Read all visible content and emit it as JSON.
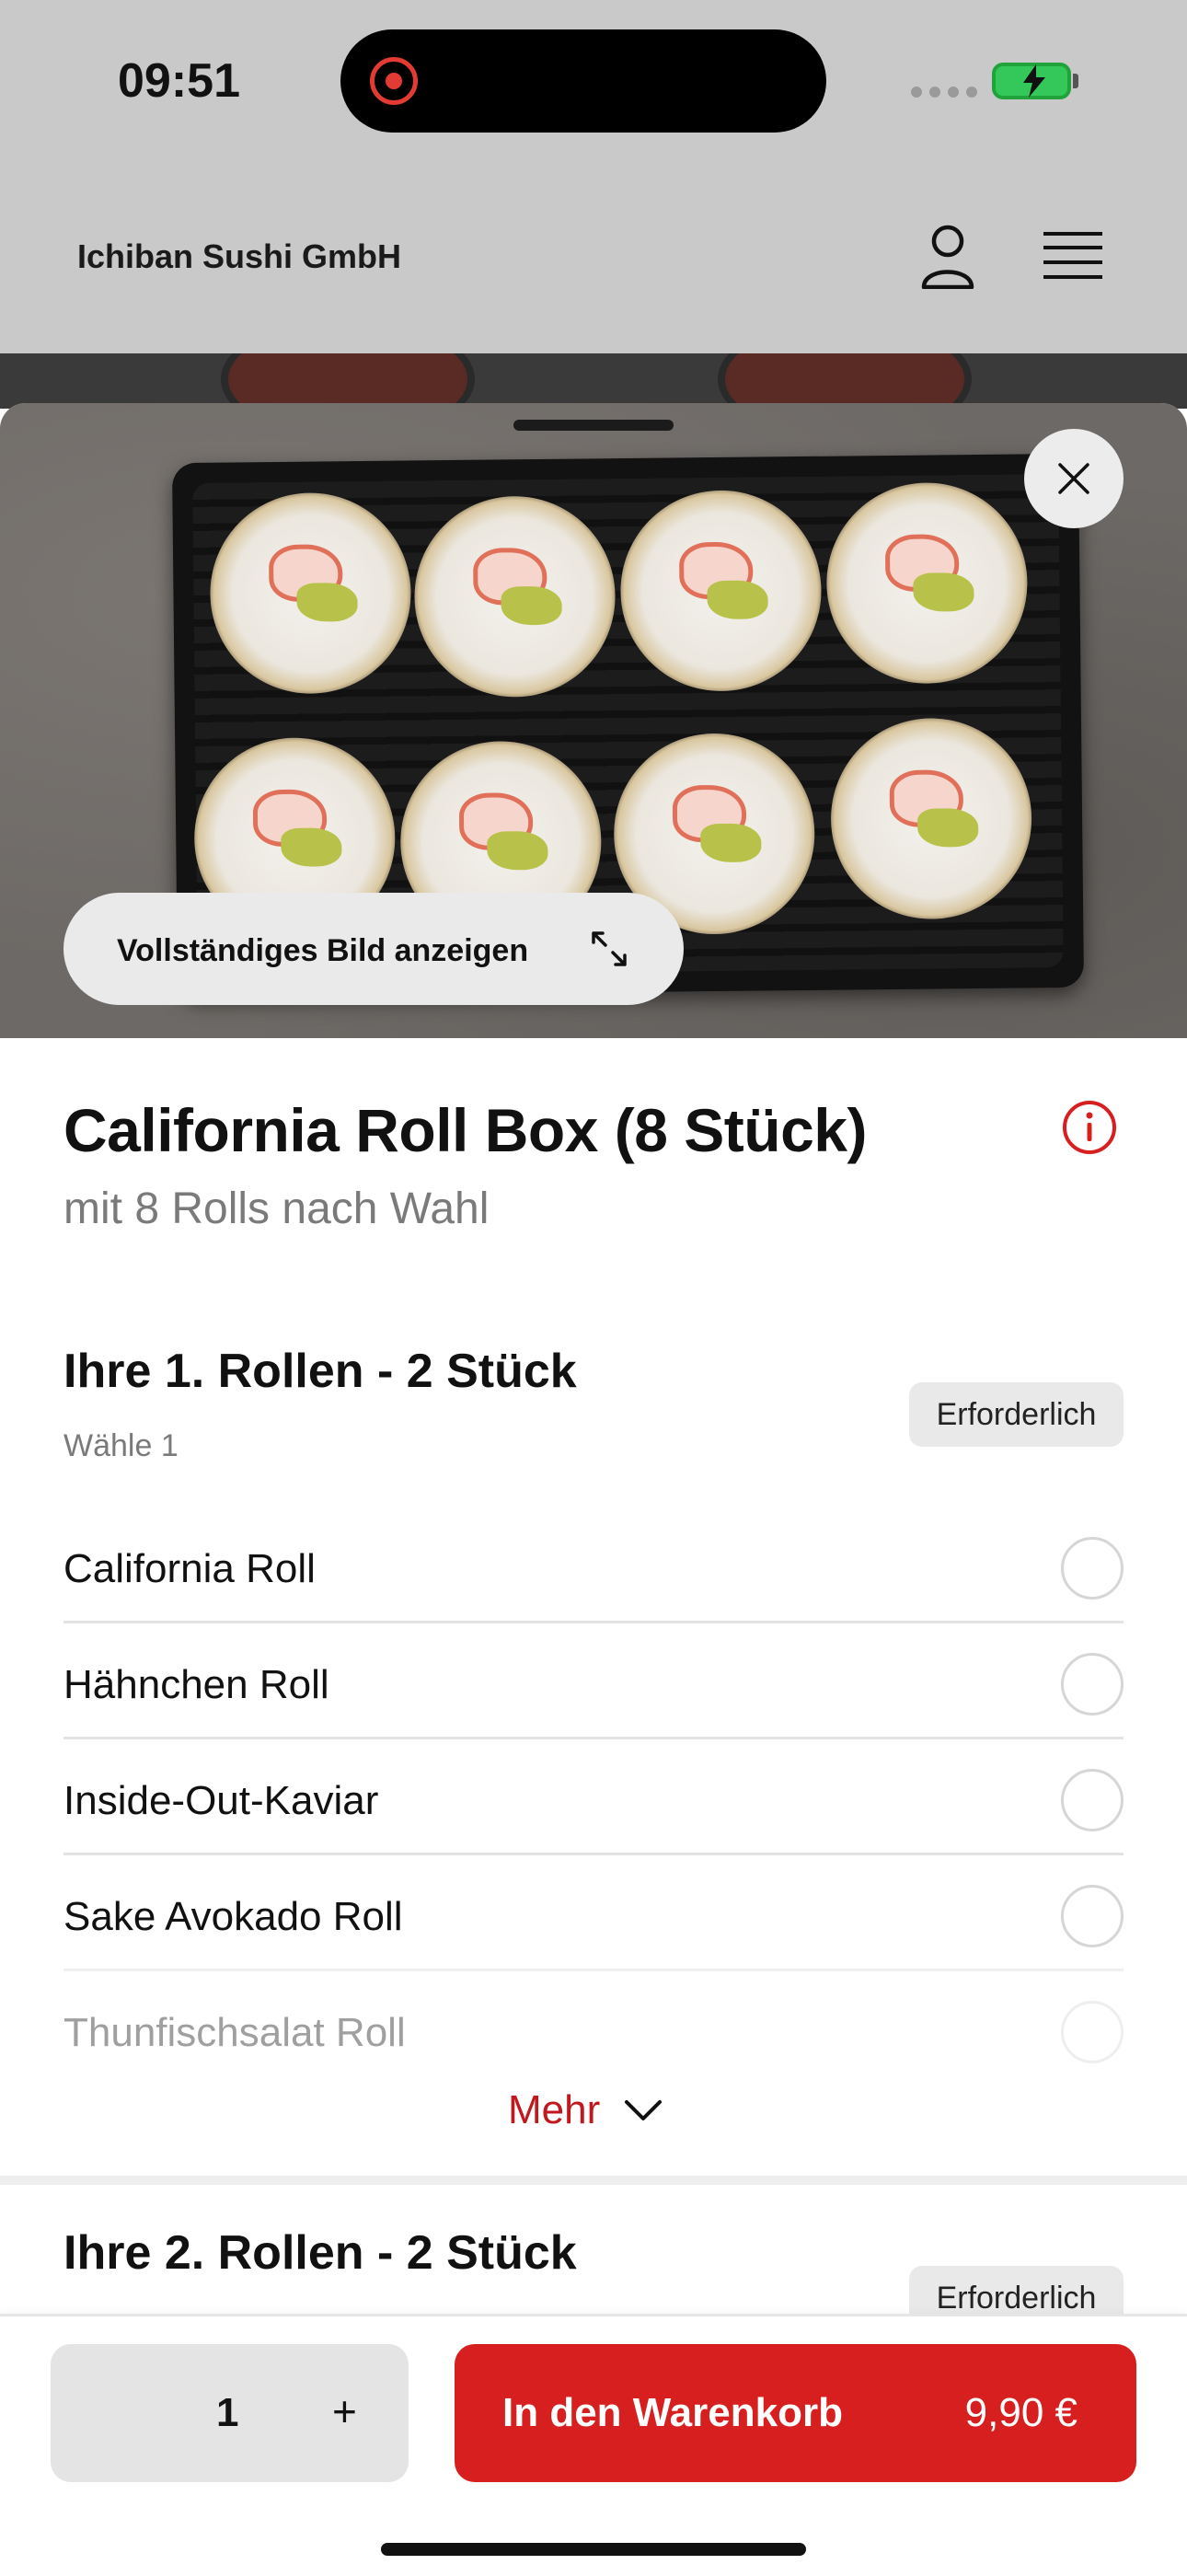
{
  "status_bar": {
    "time": "09:51"
  },
  "header": {
    "brand": "Ichiban Sushi GmbH",
    "user_icon": "user-icon",
    "menu_icon": "hamburger-menu-icon"
  },
  "hero": {
    "full_image_label": "Vollständiges Bild anzeigen"
  },
  "product": {
    "title": "California Roll Box (8 Stück)",
    "subtitle": "mit 8 Rolls nach Wahl"
  },
  "group1": {
    "title": "Ihre 1. Rollen - 2 Stück",
    "hint": "Wähle 1",
    "badge": "Erforderlich",
    "options": [
      {
        "label": "California Roll"
      },
      {
        "label": "Hähnchen Roll"
      },
      {
        "label": "Inside-Out-Kaviar"
      },
      {
        "label": "Sake Avokado Roll"
      },
      {
        "label": "Thunfischsalat Roll"
      }
    ],
    "more_label": "Mehr"
  },
  "group2": {
    "title": "Ihre 2. Rollen - 2 Stück",
    "badge": "Erforderlich"
  },
  "cart": {
    "quantity": "1",
    "plus": "+",
    "add_label": "In den Warenkorb",
    "price": "9,90 €"
  },
  "colors": {
    "accent": "#d71f1f",
    "mehr_text": "#c2181d"
  }
}
